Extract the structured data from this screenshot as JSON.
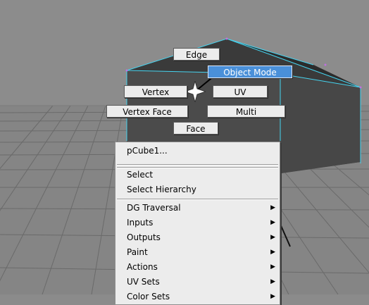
{
  "marking_menu": {
    "edge": "Edge",
    "object_mode": "Object Mode",
    "vertex": "Vertex",
    "uv": "UV",
    "vertex_face": "Vertex Face",
    "multi": "Multi",
    "face": "Face"
  },
  "context_menu": {
    "title": "pCube1...",
    "items": [
      {
        "label": "Select",
        "submenu": false
      },
      {
        "label": "Select Hierarchy",
        "submenu": false
      },
      {
        "label": "DG Traversal",
        "submenu": true
      },
      {
        "label": "Inputs",
        "submenu": true
      },
      {
        "label": "Outputs",
        "submenu": true
      },
      {
        "label": "Paint",
        "submenu": true
      },
      {
        "label": "Actions",
        "submenu": true
      },
      {
        "label": "UV Sets",
        "submenu": true
      },
      {
        "label": "Color Sets",
        "submenu": true
      }
    ],
    "submenu_glyph": "▶"
  },
  "colors": {
    "viewport_bg": "#8b8b8b",
    "grid": "#6f6f6f",
    "selection_wire": "#46d4f0",
    "highlight": "#4a90d9"
  }
}
